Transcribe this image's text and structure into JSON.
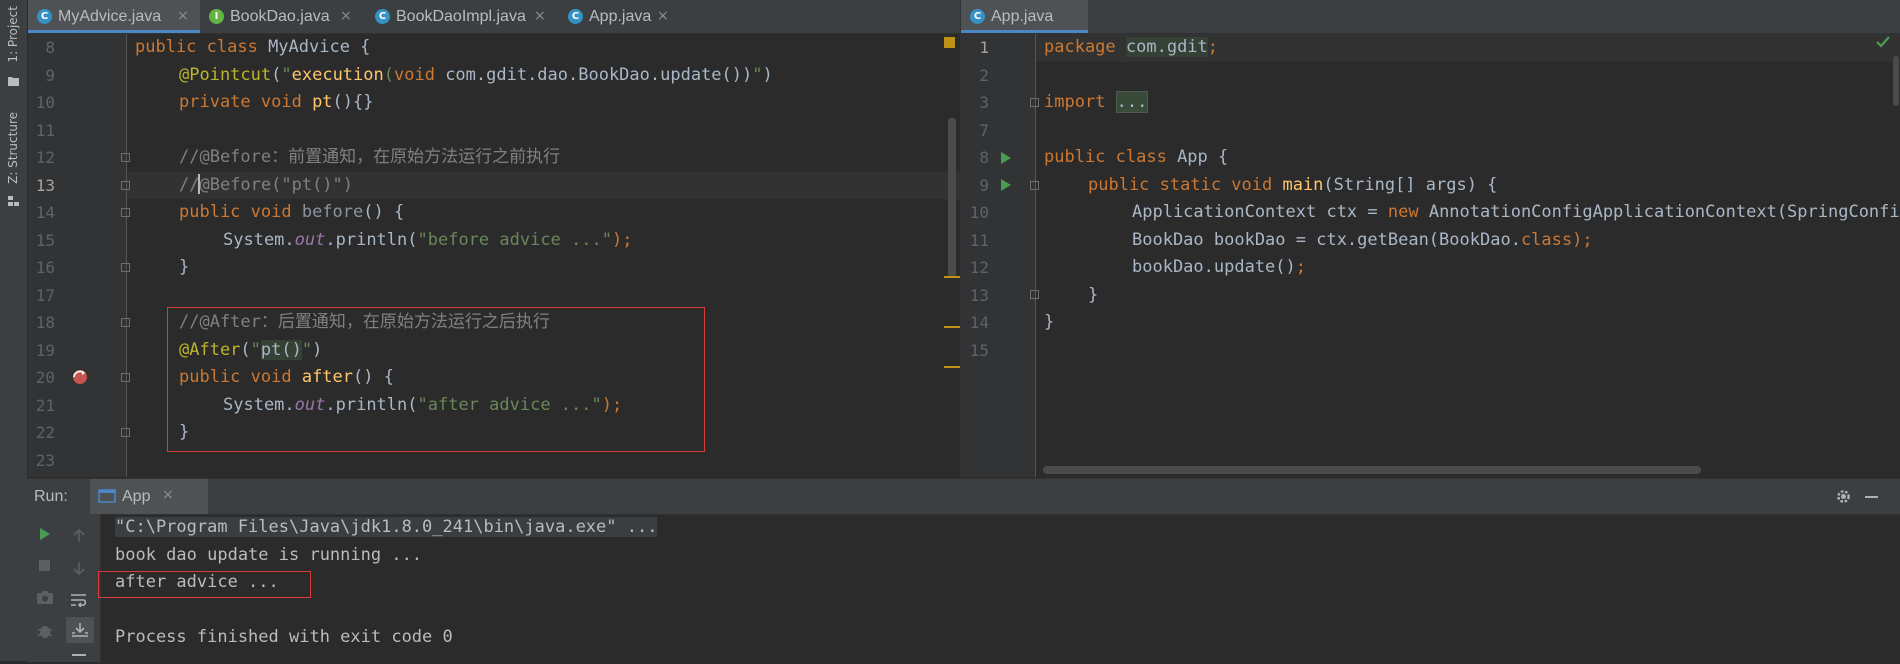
{
  "sidebar": {
    "project_label": "1: Project",
    "structure_label": "Z: Structure"
  },
  "left_editor": {
    "tabs": [
      {
        "label": "MyAdvice.java",
        "icon": "class-icon",
        "active": true
      },
      {
        "label": "BookDao.java",
        "icon": "interface-icon",
        "active": false
      },
      {
        "label": "BookDaoImpl.java",
        "icon": "class-icon",
        "active": false
      },
      {
        "label": "App.java",
        "icon": "class-icon",
        "active": false
      }
    ],
    "tab_close_glyph": "×",
    "line_numbers": [
      "8",
      "9",
      "10",
      "11",
      "12",
      "13",
      "14",
      "15",
      "16",
      "17",
      "18",
      "19",
      "20",
      "21",
      "22",
      "23"
    ],
    "current_line": "13",
    "code": {
      "l8_a": "public class ",
      "l8_b": "MyAdvice {",
      "l9_a": "@Pointcut",
      "l9_b": "(",
      "l9_c": "\"",
      "l9_d": "execution",
      "l9_e": "(",
      "l9_f": "void ",
      "l9_g": "com.gdit.dao.BookDao.update())",
      "l9_h": "\"",
      "l9_i": ")",
      "l10_a": "private void ",
      "l10_b": "pt",
      "l10_c": "(){}",
      "l12": "//@Before：前置通知，在原始方法运行之前执行",
      "l13_a": "//",
      "l13_b": "@Before(\"pt()\")",
      "l14_a": "public void ",
      "l14_b": "before",
      "l14_c": "() {",
      "l15_a": "System.",
      "l15_b": "out",
      "l15_c": ".println(",
      "l15_d": "\"before advice ...\"",
      "l15_e": ");",
      "l16": "}",
      "l18": "//@After：后置通知，在原始方法运行之后执行",
      "l19_a": "@After",
      "l19_b": "(",
      "l19_c": "\"",
      "l19_d": "pt()",
      "l19_e": "\"",
      "l19_f": ")",
      "l20_a": "public void ",
      "l20_b": "after",
      "l20_c": "() {",
      "l21_a": "System.",
      "l21_b": "out",
      "l21_c": ".println(",
      "l21_d": "\"after advice ...\"",
      "l21_e": ");",
      "l22": "}"
    }
  },
  "right_editor": {
    "tabs": [
      {
        "label": "App.java",
        "icon": "class-icon",
        "active": true
      }
    ],
    "line_numbers": [
      "1",
      "2",
      "3",
      "7",
      "8",
      "9",
      "10",
      "11",
      "12",
      "13",
      "14",
      "15"
    ],
    "code": {
      "r1_a": "package ",
      "r1_b": "com.gdit",
      "r1_c": ";",
      "r3_a": "import ",
      "r3_b": "...",
      "r8_a": "public class ",
      "r8_b": "App {",
      "r9_a": "public static void ",
      "r9_b": "main",
      "r9_c": "(String[] args) {",
      "r10_a": "ApplicationContext ctx = ",
      "r10_b": "new ",
      "r10_c": "AnnotationConfigApplicationContext(SpringConfig.",
      "r11_a": "BookDao bookDao = ctx.getBean(BookDao.",
      "r11_b": "class",
      "r11_c": ");",
      "r12_a": "bookDao.update()",
      "r12_b": ";",
      "r13": "}",
      "r14": "}"
    }
  },
  "run_panel": {
    "label": "Run:",
    "tab_label": "App",
    "close_glyph": "×",
    "console": [
      "\"C:\\Program Files\\Java\\jdk1.8.0_241\\bin\\java.exe\" ...",
      "book dao update is running ...",
      "after advice ...",
      "",
      "Process finished with exit code 0"
    ],
    "tool_icons": [
      "run-icon",
      "stop-icon",
      "camera-icon",
      "bug-icon",
      "up-arrow-icon",
      "down-arrow-icon",
      "soft-wrap-icon",
      "scroll-to-end-icon"
    ]
  },
  "colors": {
    "accent_blue": "#4a88c7",
    "run_green": "#499c54",
    "highlight_red": "#d93a3a",
    "keyword": "#cc7832",
    "string": "#6a8759",
    "annotation": "#bbb529",
    "function": "#ffc66d"
  }
}
